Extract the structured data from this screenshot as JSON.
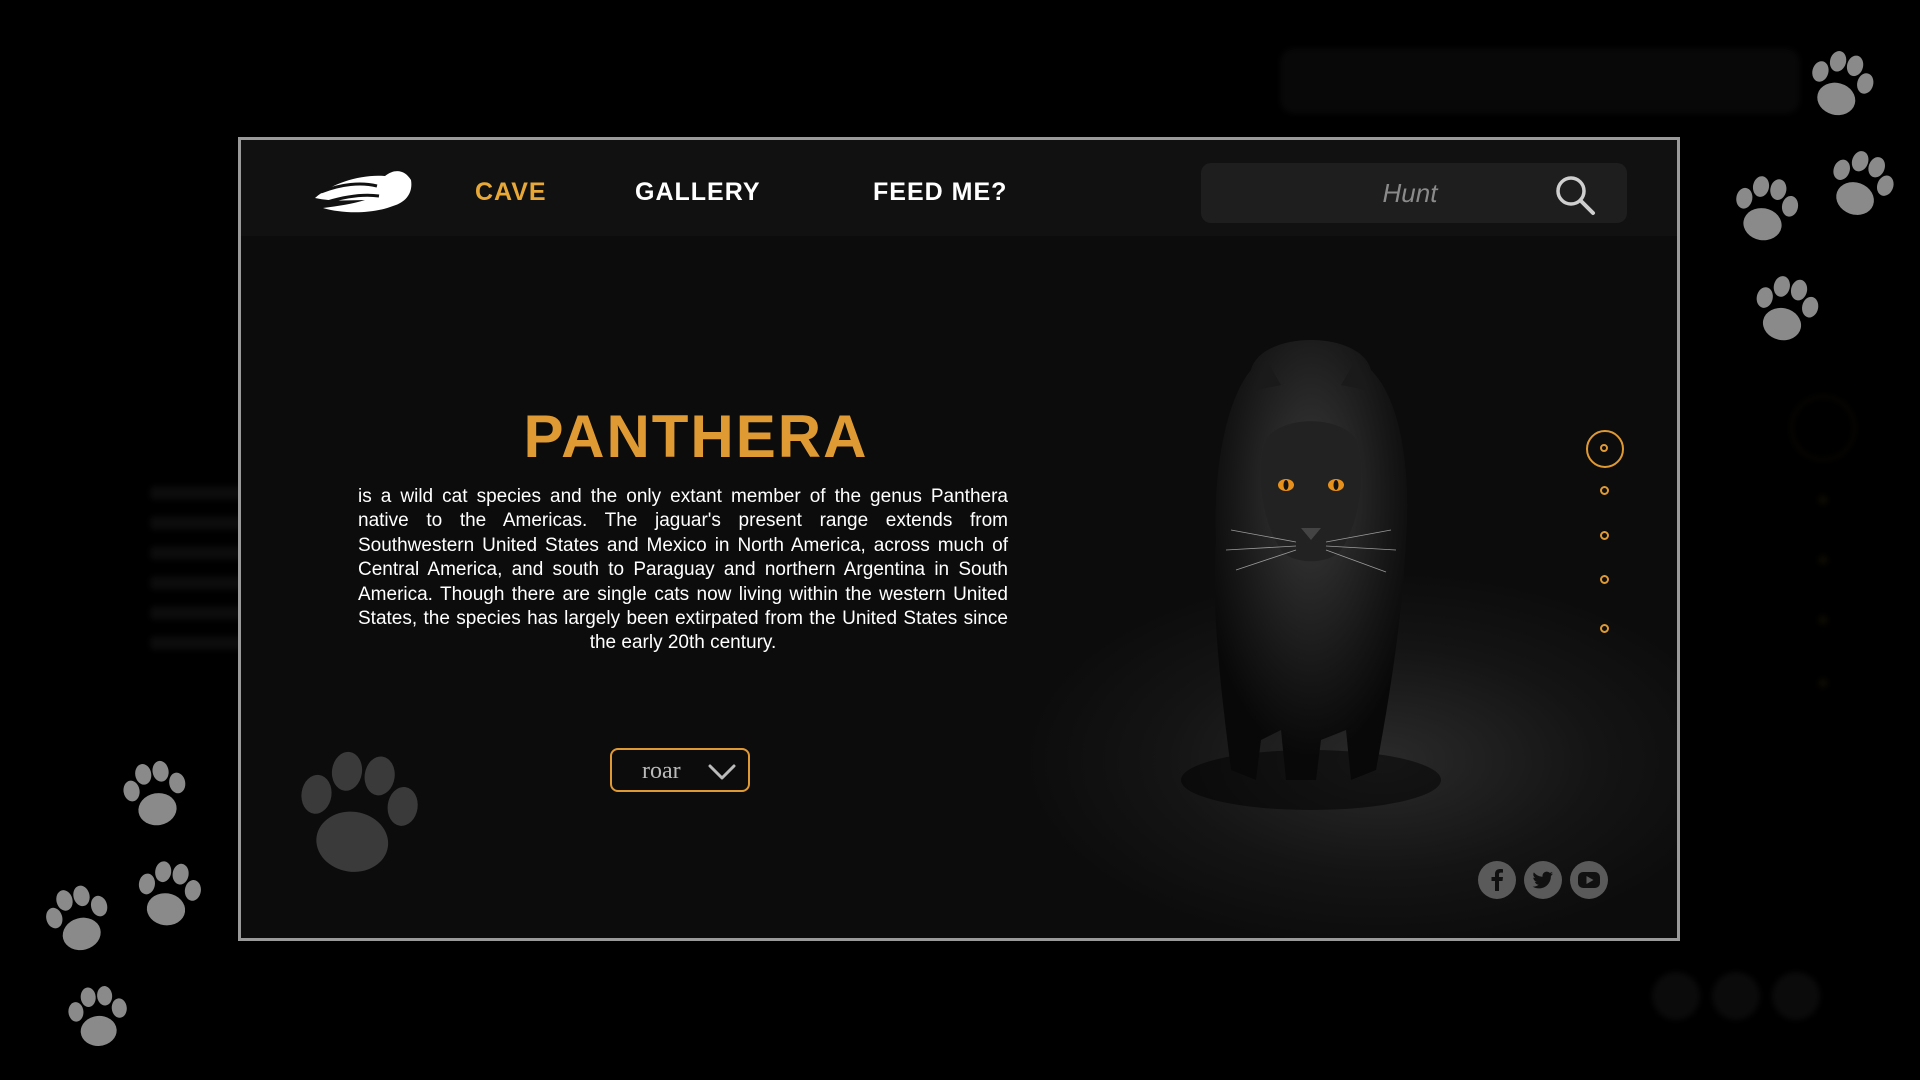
{
  "nav": {
    "items": [
      {
        "label": "CAVE",
        "active": true
      },
      {
        "label": "GALLERY",
        "active": false
      },
      {
        "label": "FEED ME?",
        "active": false
      }
    ]
  },
  "search": {
    "placeholder": "Hunt"
  },
  "hero": {
    "title": "PANTHERA",
    "description": "is a wild cat species and the only extant member of the genus Panthera native to the Americas. The jaguar's present range extends from Southwestern United States and Mexico in North America, across much of Central America, and south to Paraguay and northern Argentina in South America. Though there are single cats now living within the western United States, the species has largely been extirpated from the United States since the early 20th century.",
    "button_label": "roar"
  },
  "slides": {
    "count": 5,
    "active_index": 0
  },
  "social": [
    "facebook-icon",
    "twitter-icon",
    "youtube-icon"
  ],
  "colors": {
    "accent": "#e09a34",
    "background": "#0c0c0c",
    "text": "#ffffff"
  }
}
